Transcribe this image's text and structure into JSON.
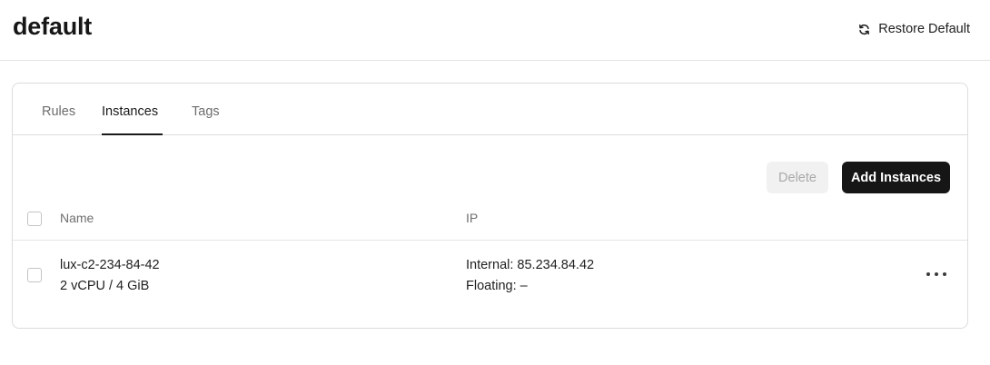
{
  "header": {
    "title": "default",
    "restore_label": "Restore Default",
    "restore_icon": "refresh-icon"
  },
  "tabs": [
    {
      "label": "Rules",
      "active": false
    },
    {
      "label": "Instances",
      "active": true
    },
    {
      "label": "Tags",
      "active": false
    }
  ],
  "toolbar": {
    "delete_label": "Delete",
    "delete_enabled": false,
    "add_label": "Add Instances"
  },
  "table": {
    "columns": [
      "Name",
      "IP"
    ],
    "rows": [
      {
        "name": "lux-c2-234-84-42",
        "spec": "2 vCPU / 4 GiB",
        "internal_ip": "Internal: 85.234.84.42",
        "floating_ip": "Floating: –",
        "selected": false
      }
    ]
  },
  "colors": {
    "primary_button": "#161616",
    "disabled_button": "#f1f1f1",
    "border": "#dcdcdc"
  }
}
